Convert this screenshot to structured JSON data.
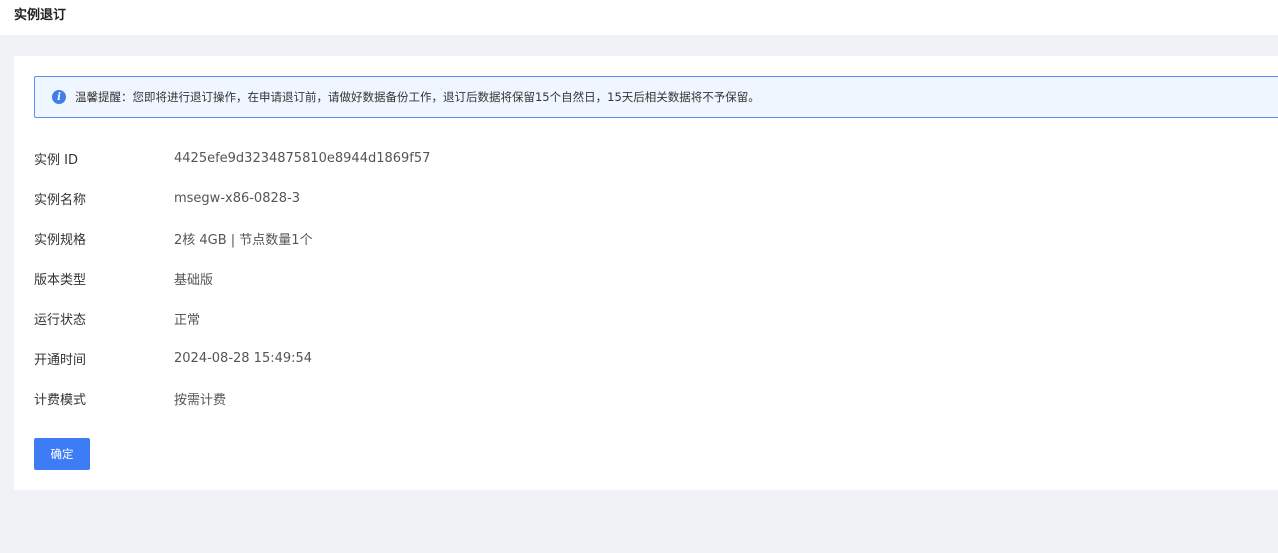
{
  "header": {
    "title": "实例退订"
  },
  "notice": {
    "icon": "info-icon",
    "text": "温馨提醒：您即将进行退订操作，在申请退订前，请做好数据备份工作，退订后数据将保留15个自然日，15天后相关数据将不予保留。"
  },
  "details": [
    {
      "label": "实例 ID",
      "value": "4425efe9d3234875810e8944d1869f57"
    },
    {
      "label": "实例名称",
      "value": "msegw-x86-0828-3"
    },
    {
      "label": "实例规格",
      "value": "2核 4GB | 节点数量1个"
    },
    {
      "label": "版本类型",
      "value": "基础版"
    },
    {
      "label": "运行状态",
      "value": "正常"
    },
    {
      "label": "开通时间",
      "value": "2024-08-28 15:49:54"
    },
    {
      "label": "计费模式",
      "value": "按需计费"
    }
  ],
  "actions": {
    "confirm_label": "确定"
  },
  "colors": {
    "accent": "#3d7cf4",
    "notice_bg": "#f0f6ff",
    "notice_border": "#5b8ef0",
    "page_bg": "#f0f2f5"
  }
}
